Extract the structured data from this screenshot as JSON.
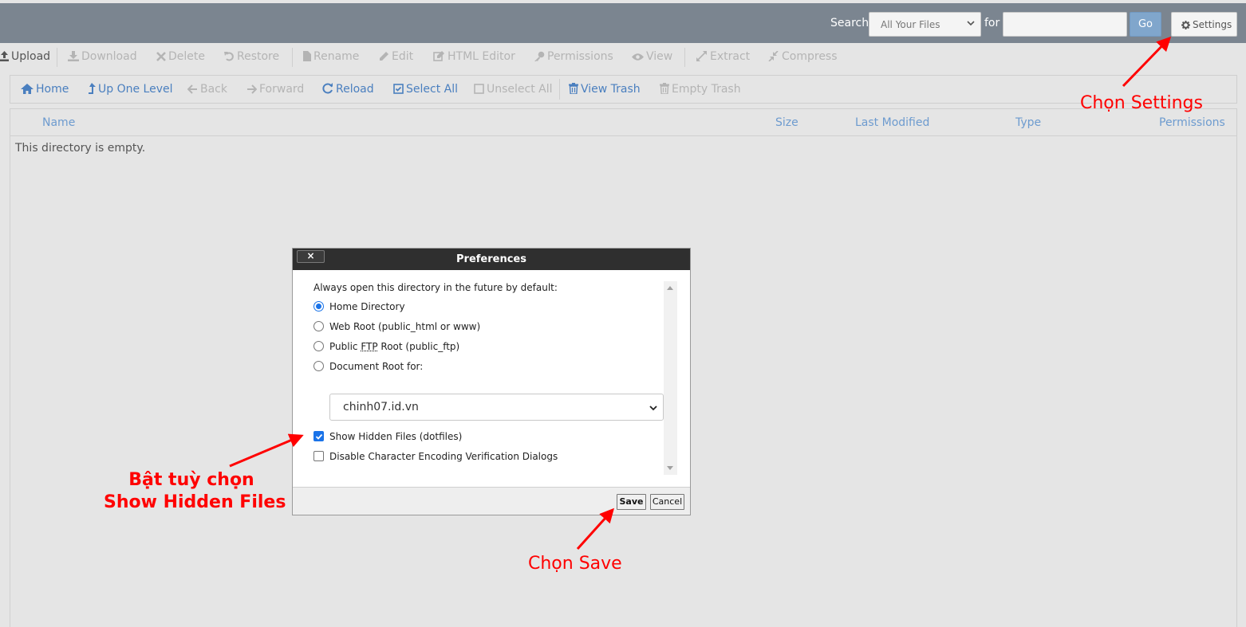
{
  "search": {
    "label": "Search",
    "scope_selected": "All Your Files",
    "for_label": "for",
    "query_value": "",
    "go_label": "Go",
    "settings_label": "Settings"
  },
  "toolbar": {
    "upload": "Upload",
    "download": "Download",
    "delete": "Delete",
    "restore": "Restore",
    "rename": "Rename",
    "edit": "Edit",
    "html_editor": "HTML Editor",
    "permissions": "Permissions",
    "view": "View",
    "extract": "Extract",
    "compress": "Compress"
  },
  "nav": {
    "home": "Home",
    "up_one_level": "Up One Level",
    "back": "Back",
    "forward": "Forward",
    "reload": "Reload",
    "select_all": "Select All",
    "unselect_all": "Unselect All",
    "view_trash": "View Trash",
    "empty_trash": "Empty Trash"
  },
  "table": {
    "columns": [
      "Name",
      "Size",
      "Last Modified",
      "Type",
      "Permissions"
    ],
    "empty_message": "This directory is empty."
  },
  "dialog": {
    "title": "Preferences",
    "close_label": "×",
    "intro": "Always open this directory in the future by default:",
    "options": {
      "home": "Home Directory",
      "web_root": "Web Root (public_html or www)",
      "public_prefix": "Public ",
      "ftp_abbr": "FTP",
      "public_suffix": " Root (public_ftp)",
      "doc_root": "Document Root for:"
    },
    "selected_option": "Home Directory",
    "domain_selected": "chinh07.id.vn",
    "show_hidden": "Show Hidden Files (dotfiles)",
    "show_hidden_checked": true,
    "disable_encoding": "Disable Character Encoding Verification Dialogs",
    "disable_encoding_checked": false,
    "save_label": "Save",
    "cancel_label": "Cancel"
  },
  "annotations": {
    "settings": "Chọn Settings",
    "hidden_line1": "Bật tuỳ chọn",
    "hidden_line2": "Show Hidden Files",
    "save": "Chọn Save",
    "color": "#ff0000"
  },
  "colors": {
    "topbar": "#7b8590",
    "link": "#4a7fbf",
    "go_button": "#80a6cc",
    "dialog_title": "#2f2f2f",
    "checkbox_accent": "#1a73e8"
  }
}
